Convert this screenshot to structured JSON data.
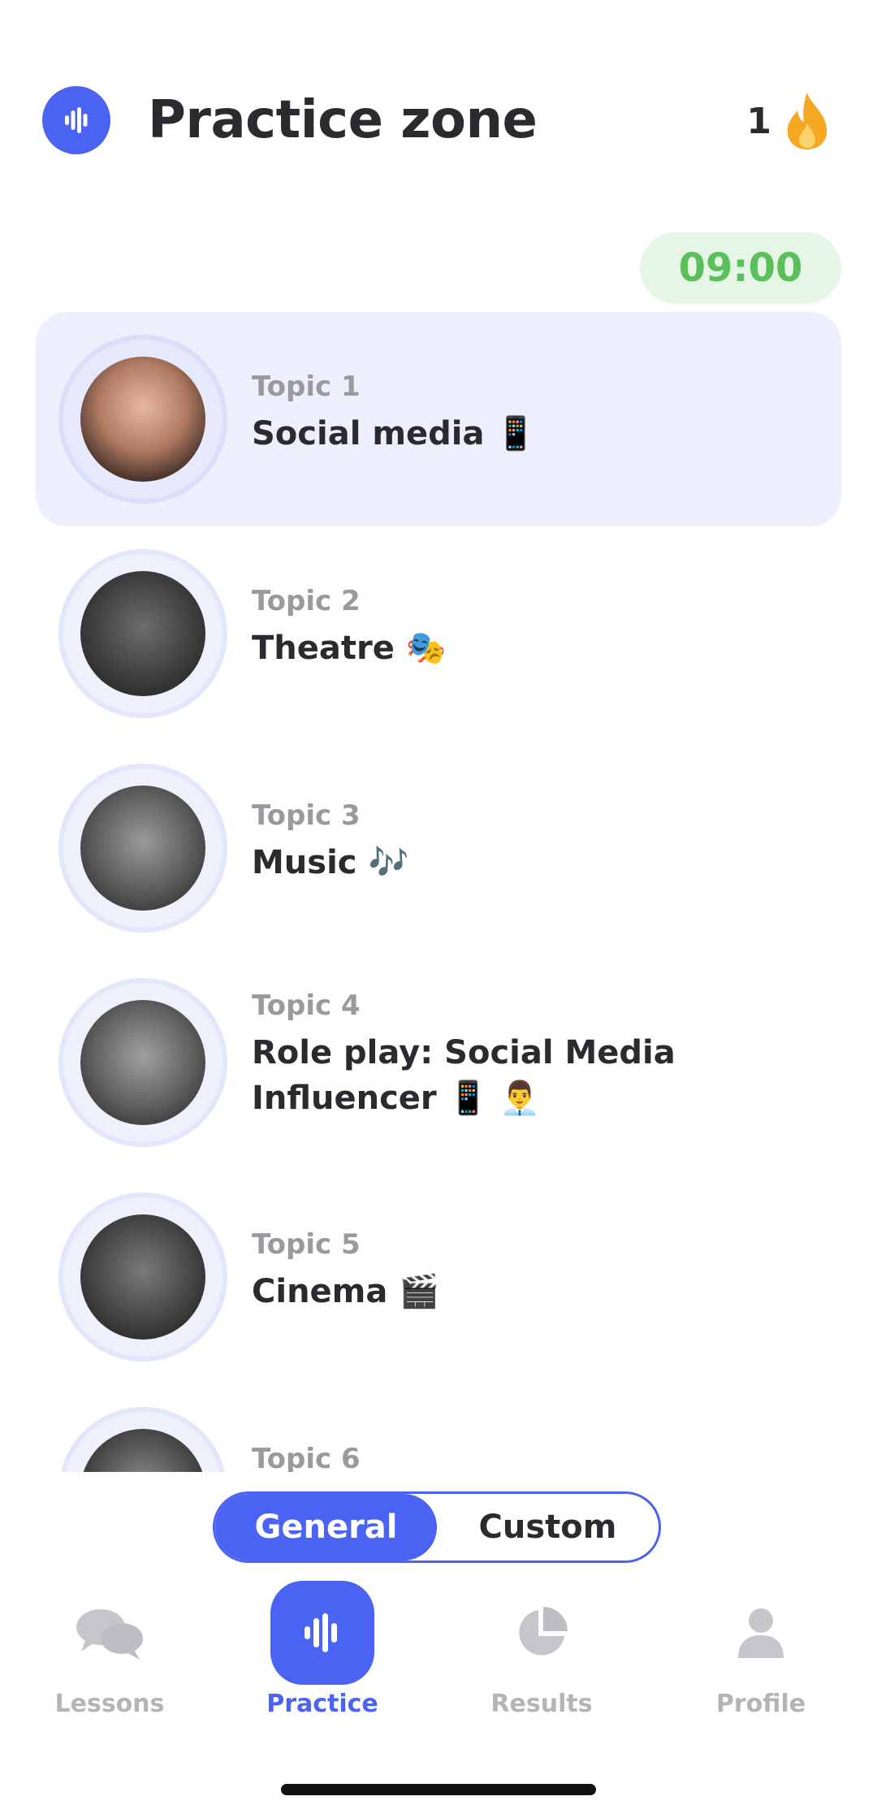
{
  "header": {
    "title": "Practice zone",
    "streak_count": "1",
    "streak_icon": "flame-icon",
    "logo_icon": "soundwave-icon"
  },
  "timer": {
    "value": "09:00"
  },
  "topics": [
    {
      "number": "Topic 1",
      "name": "Social media 📱",
      "selected": true
    },
    {
      "number": "Topic 2",
      "name": "Theatre 🎭",
      "selected": false
    },
    {
      "number": "Topic 3",
      "name": "Music 🎶",
      "selected": false
    },
    {
      "number": "Topic 4",
      "name": "Role play: Social Media Influencer 📱 👨‍💼",
      "selected": false
    },
    {
      "number": "Topic 5",
      "name": "Cinema 🎬",
      "selected": false
    },
    {
      "number": "Topic 6",
      "name": "",
      "selected": false
    }
  ],
  "segmented": {
    "general": "General",
    "custom": "Custom",
    "selected": "General"
  },
  "tabbar": {
    "items": [
      {
        "label": "Lessons",
        "icon": "chat-bubbles-icon"
      },
      {
        "label": "Practice",
        "icon": "soundwave-icon",
        "active": true
      },
      {
        "label": "Results",
        "icon": "pie-chart-icon"
      },
      {
        "label": "Profile",
        "icon": "person-icon"
      }
    ]
  },
  "colors": {
    "accent": "#4a63f2",
    "timer_bg": "#e6f6e6",
    "timer_text": "#5bbf5b",
    "selected_row_bg": "#edeffc",
    "flame": "#f7a823"
  }
}
